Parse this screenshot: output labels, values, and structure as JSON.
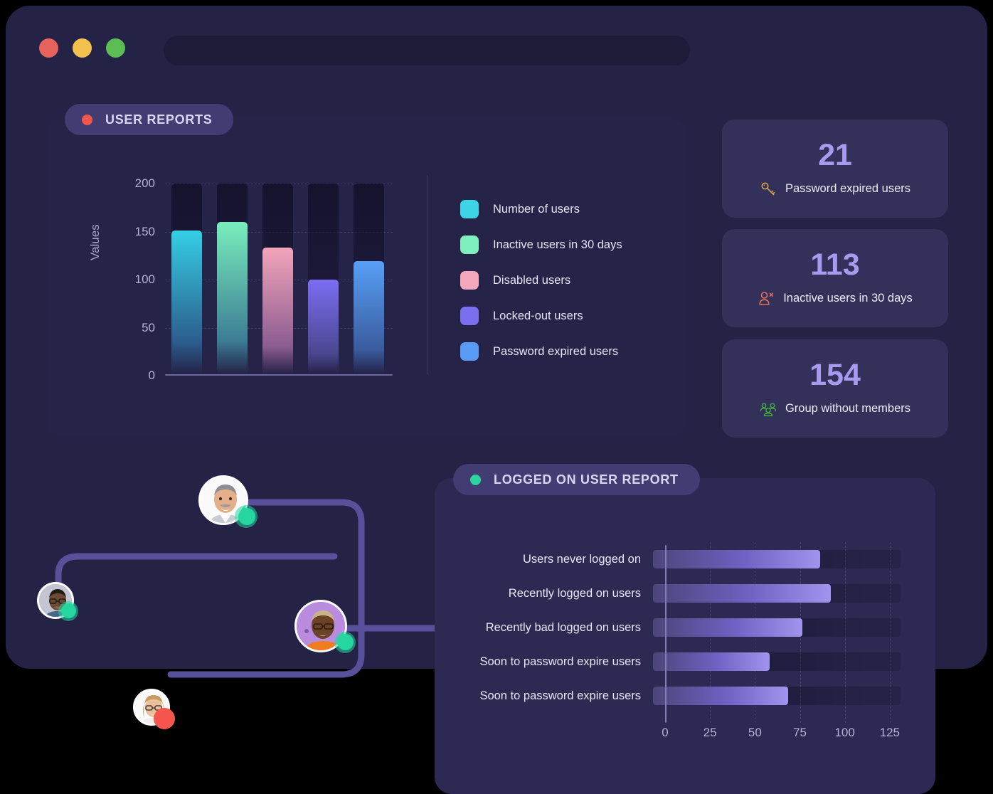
{
  "window": {
    "traffic_lights": [
      {
        "name": "close",
        "color": "#E8635C"
      },
      {
        "name": "minimize",
        "color": "#F3C24E"
      },
      {
        "name": "maximize",
        "color": "#5CBD52"
      }
    ],
    "address_bar_value": "",
    "address_bar_placeholder": ""
  },
  "user_reports": {
    "badge_label": "USER REPORTS",
    "badge_dot_color": "#F0574C"
  },
  "logged_on_report": {
    "badge_label": "LOGGED ON USER REPORT",
    "badge_dot_color": "#2BD49B"
  },
  "stat_cards": [
    {
      "value": "21",
      "label": "Password expired users",
      "icon": "key-icon",
      "icon_color": "#D4A34A"
    },
    {
      "value": "113",
      "label": "Inactive users in 30 days",
      "icon": "user-remove-icon",
      "icon_color": "#E2715F"
    },
    {
      "value": "154",
      "label": "Group without members",
      "icon": "group-icon",
      "icon_color": "#3FA83F"
    }
  ],
  "chart_data": [
    {
      "type": "bar",
      "title": "USER REPORTS",
      "orientation": "vertical",
      "xlabel": "",
      "ylabel": "Values",
      "ylim": [
        0,
        200
      ],
      "yticks": [
        0,
        50,
        100,
        150,
        200
      ],
      "grid": true,
      "legend_position": "right",
      "categories": [
        "Number of users",
        "Inactive users in 30 days",
        "Disabled users",
        "Locked-out users",
        "Password expired users"
      ],
      "values": [
        151,
        160,
        133,
        99,
        119
      ],
      "colors": [
        "#3CD5E8",
        "#7FEFBD",
        "#F5A8BC",
        "#7B6FF0",
        "#5A9BF5"
      ],
      "bar_gradients": [
        {
          "top": "#35CFE6",
          "bottom": "#2B5C8C"
        },
        {
          "top": "#79EEBC",
          "bottom": "#3C7D94"
        },
        {
          "top": "#F3A5BA",
          "bottom": "#8C5C91"
        },
        {
          "top": "#7C6DF2",
          "bottom": "#4A478F"
        },
        {
          "top": "#57A0F7",
          "bottom": "#3A5C9E"
        }
      ]
    },
    {
      "type": "bar",
      "title": "LOGGED ON USER REPORT",
      "orientation": "horizontal",
      "xlabel": "",
      "ylabel": "",
      "xlim": [
        0,
        131
      ],
      "xticks": [
        0,
        25,
        50,
        75,
        100,
        125
      ],
      "grid": true,
      "categories": [
        "Users never logged on",
        "Recently logged on users",
        "Recently bad logged on users",
        "Soon to password expire users",
        "Soon to password expire users"
      ],
      "values": [
        93,
        99,
        83,
        65,
        75
      ],
      "bar_color": "#A194EE"
    }
  ],
  "avatars": [
    {
      "name": "avatar-user-1",
      "status": "online",
      "skin": "#E3B08A",
      "hair": "#8E8E94",
      "shirt": "#C9CBD4",
      "bg": "#FFFFFF"
    },
    {
      "name": "avatar-user-2",
      "status": "online",
      "skin": "#6E4A33",
      "hair": "#241A14",
      "shirt": "#4A6B8A",
      "bg": "#C8CBD6"
    },
    {
      "name": "avatar-user-3",
      "status": "online",
      "skin": "#6B4226",
      "hair": "#C9B38A",
      "shirt": "#F07C20",
      "bg": "#B98CE0"
    },
    {
      "name": "avatar-user-4",
      "status": "offline",
      "skin": "#EAC09A",
      "hair": "#C79A5E",
      "shirt": "#F2EDEA",
      "bg": "#FFFFFF"
    }
  ]
}
